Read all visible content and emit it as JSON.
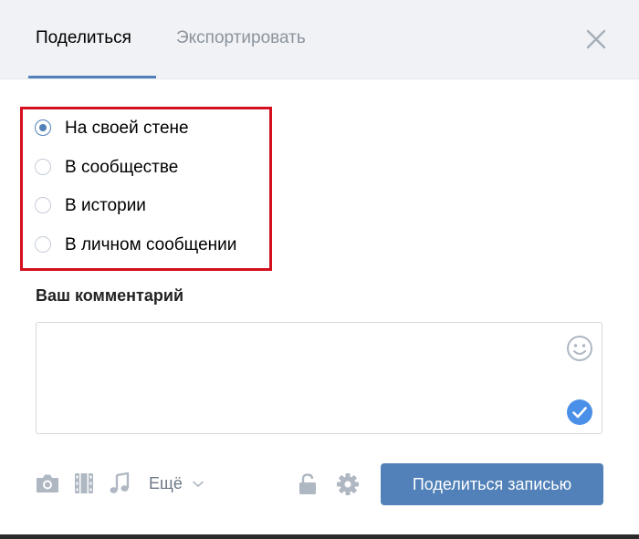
{
  "tabs": [
    {
      "label": "Поделиться",
      "active": true
    },
    {
      "label": "Экспортировать",
      "active": false
    }
  ],
  "share_options": [
    {
      "label": "На своей стене",
      "checked": true
    },
    {
      "label": "В сообществе",
      "checked": false
    },
    {
      "label": "В истории",
      "checked": false
    },
    {
      "label": "В личном сообщении",
      "checked": false
    }
  ],
  "comment": {
    "label": "Ваш комментарий",
    "value": ""
  },
  "toolbar": {
    "more_label": "Ещё",
    "icons": [
      "camera-icon",
      "video-icon",
      "music-icon",
      "lock-icon",
      "gear-icon"
    ]
  },
  "submit_label": "Поделиться записью",
  "colors": {
    "accent": "#5181b8",
    "highlight": "#d4101e",
    "checkmark": "#4a90e8",
    "icon_gray": "#aeb7c2"
  }
}
